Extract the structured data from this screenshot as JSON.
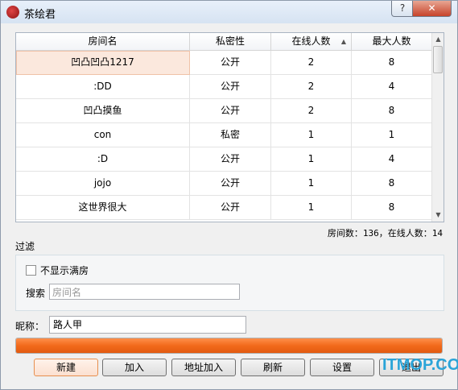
{
  "window": {
    "title": "茶绘君",
    "help_label": "?",
    "close_label": "✕"
  },
  "table": {
    "columns": [
      "房间名",
      "私密性",
      "在线人数",
      "最大人数"
    ],
    "sort_indicator": "▲",
    "rows": [
      {
        "name": "凹凸凹凸1217",
        "privacy": "公开",
        "online": "2",
        "max": "8"
      },
      {
        "name": ":DD",
        "privacy": "公开",
        "online": "2",
        "max": "4"
      },
      {
        "name": "凹凸摸鱼",
        "privacy": "公开",
        "online": "2",
        "max": "8"
      },
      {
        "name": "con",
        "privacy": "私密",
        "online": "1",
        "max": "1"
      },
      {
        "name": ":D",
        "privacy": "公开",
        "online": "1",
        "max": "4"
      },
      {
        "name": "jojo",
        "privacy": "公开",
        "online": "1",
        "max": "8"
      },
      {
        "name": "这世界很大",
        "privacy": "公开",
        "online": "1",
        "max": "8"
      }
    ],
    "scroll_up": "▲",
    "scroll_down": "▼"
  },
  "stats": "房间数：136，在线人数：14",
  "filter": {
    "title": "过滤",
    "hide_full_label": "不显示满房",
    "hide_full_checked": false,
    "search_label": "搜索",
    "search_placeholder": "房间名"
  },
  "nickname": {
    "label": "昵称：",
    "value": "路人甲"
  },
  "progress": {
    "value": 1.0,
    "color": "#f26a1b"
  },
  "buttons": {
    "new": "新建",
    "join": "加入",
    "address_join": "地址加入",
    "refresh": "刷新",
    "settings": "设置",
    "exit": "退出"
  },
  "watermark": "ITMOP.COM"
}
